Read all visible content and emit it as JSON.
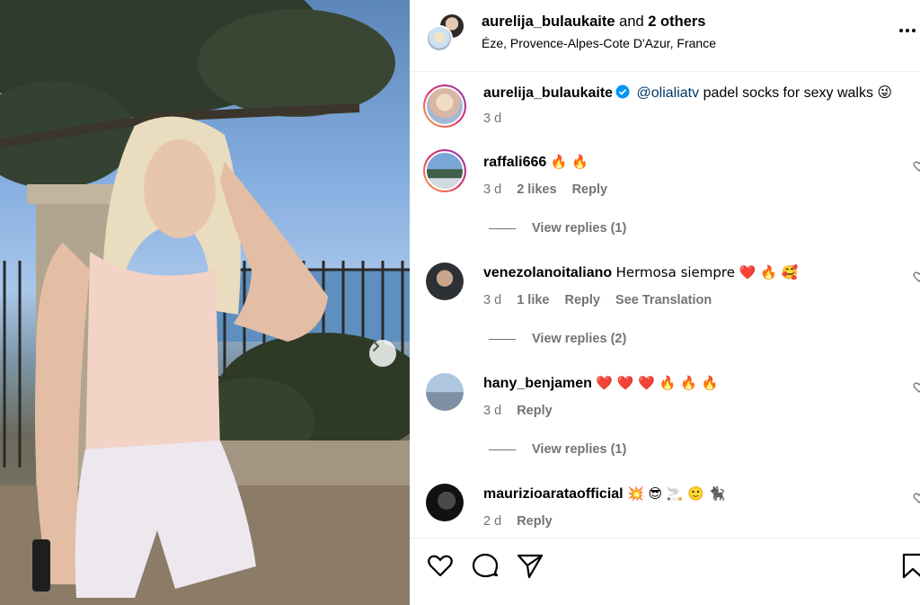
{
  "post": {
    "header": {
      "username": "aurelija_bulaukaite",
      "and_text": "and",
      "others": "2 others",
      "location": "Éze, Provence-Alpes-Cote D'Azur, France",
      "more_icon": "more-horizontal-icon"
    },
    "caption": {
      "username": "aurelija_bulaukaite",
      "mention": "@olialiatv",
      "text": "padel socks for sexy walks 😜",
      "time": "3 d"
    },
    "comments": [
      {
        "username": "raffali666",
        "text": "🔥 🔥",
        "time": "3 d",
        "likes": "2 likes",
        "reply": "Reply",
        "view_replies": "View replies (1)"
      },
      {
        "username": "venezolanoitaliano",
        "text": "Hermosa siempre ❤️ 🔥 🥰",
        "time": "3 d",
        "likes": "1 like",
        "reply": "Reply",
        "translation": "See Translation",
        "view_replies": "View replies (2)"
      },
      {
        "username": "hany_benjamen",
        "text": "❤️ ❤️ ❤️ 🔥 🔥 🔥",
        "time": "3 d",
        "reply": "Reply",
        "view_replies": "View replies (1)"
      },
      {
        "username": "maurizioarataofficial",
        "text": "💥 😎 🚬 🙂 🐈‍⬛",
        "time": "2 d",
        "reply": "Reply"
      }
    ],
    "actions": [
      "heart-icon",
      "comment-icon",
      "share-icon",
      "bookmark-icon"
    ],
    "carousel_next_icon": "chevron-right-icon",
    "colors": {
      "text": "#000000",
      "secondary": "#737373",
      "mention": "#00376b",
      "verified": "#0095f6",
      "divider": "#efefef"
    }
  }
}
